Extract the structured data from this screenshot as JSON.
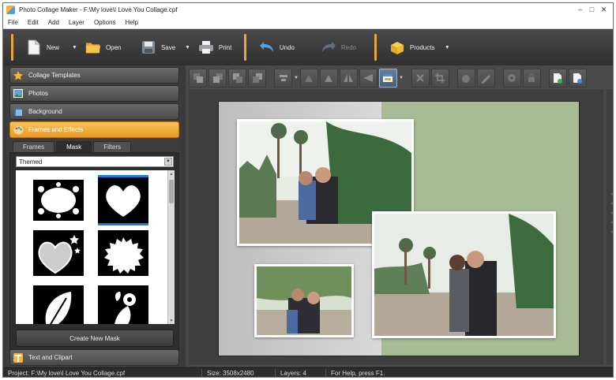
{
  "window": {
    "title": "Photo Collage Maker - F:\\My love\\I Love You Collage.cpf"
  },
  "menu": [
    "File",
    "Edit",
    "Add",
    "Layer",
    "Options",
    "Help"
  ],
  "toolbar": {
    "new_label": "New",
    "open_label": "Open",
    "save_label": "Save",
    "print_label": "Print",
    "undo_label": "Undo",
    "redo_label": "Redo",
    "products_label": "Products"
  },
  "left_panel": {
    "tabs": [
      "Collage Templates",
      "Photos",
      "Background",
      "Frames and Effects",
      "Text and Clipart"
    ],
    "active_tab": "Frames and Effects",
    "sub_tabs": [
      "Frames",
      "Mask",
      "Filters"
    ],
    "selected_sub_tab": "Mask",
    "category_select": "Themed",
    "create_button": "Create New Mask"
  },
  "status": {
    "project": "Project: F:\\My love\\I Love You Collage.cpf",
    "size": "Size: 3508x2480",
    "layers": "Layers: 4",
    "help": "For Help, press F1."
  },
  "colors": {
    "accent": "#f0a83a",
    "canvas_green": "#a6bb96",
    "toolbar_dark": "#3a3a3a"
  }
}
